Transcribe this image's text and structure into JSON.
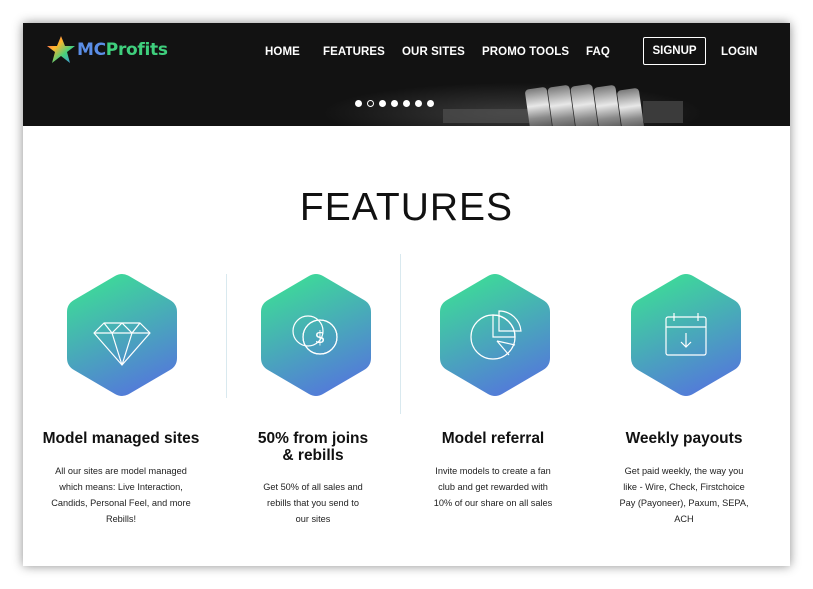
{
  "brand": {
    "logo_prefix": "MC",
    "logo_suffix": "Profits",
    "colors": {
      "logo_green": "#3fcf7d",
      "logo_blue": "#5b8ee6",
      "gradient_top": "#3ddc97",
      "gradient_bottom": "#5476dc",
      "header_bg": "#121212"
    }
  },
  "nav": {
    "items": [
      {
        "label": "HOME"
      },
      {
        "label": "FEATURES"
      },
      {
        "label": "OUR SITES"
      },
      {
        "label": "PROMO TOOLS"
      },
      {
        "label": "FAQ"
      }
    ],
    "signup_label": "SIGNUP",
    "login_label": "LOGIN"
  },
  "slider": {
    "slide_count": 7,
    "active_index": 1
  },
  "features": {
    "title": "FEATURES",
    "items": [
      {
        "icon": "diamond-icon",
        "title_lines": [
          "Model managed sites"
        ],
        "desc_lines": [
          "All our sites are model managed",
          "which means: Live Interaction,",
          "Candids, Personal Feel, and more",
          "Rebills!"
        ]
      },
      {
        "icon": "coins-icon",
        "title_lines": [
          "50% from joins",
          "& rebills"
        ],
        "desc_lines": [
          "Get 50% of all sales and",
          "rebills that you send to",
          "our sites"
        ]
      },
      {
        "icon": "pie-chart-icon",
        "title_lines": [
          "Model referral"
        ],
        "desc_lines": [
          "Invite models to create a fan",
          "club and get rewarded with",
          "10% of our share on all sales"
        ]
      },
      {
        "icon": "calendar-icon",
        "title_lines": [
          "Weekly payouts"
        ],
        "desc_lines": [
          "Get paid weekly, the way you",
          "like - Wire, Check, Firstchoice",
          "Pay (Payoneer), Paxum, SEPA,",
          "ACH"
        ]
      }
    ]
  }
}
